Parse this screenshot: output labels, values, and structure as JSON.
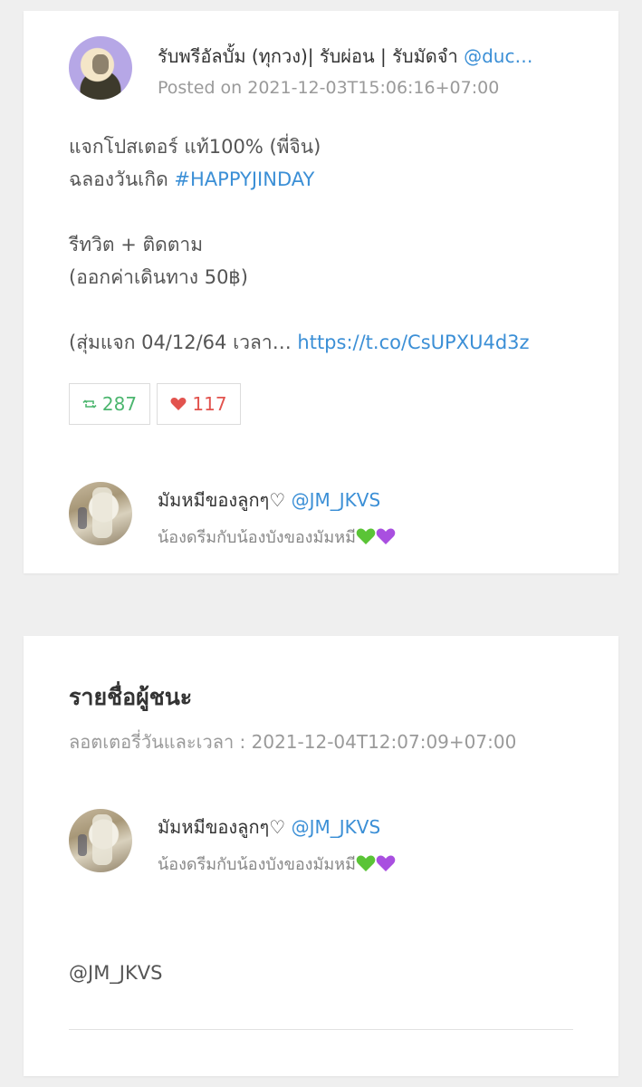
{
  "post": {
    "title_prefix": "รับพรีอัลบั้ม (ทุกวง)| รับผ่อน | รับมัดจำ",
    "title_handle": "@duc…",
    "posted": "Posted on 2021-12-03T15:06:16+07:00",
    "lines": [
      "แจกโปสเตอร์ แท้100% (พี่จิน)",
      "ฉลองวันเกิด"
    ],
    "hashtag": "#HAPPYJINDAY",
    "lines2": [
      "รีทวิต + ติดตาม",
      "(ออกค่าเดินทาง 50฿)"
    ],
    "draw_text": "(สุ่มแจก 04/12/64 เวลา…",
    "link": "https://t.co/CsUPXU4d3z",
    "retweets": "287",
    "likes": "117",
    "icons": {
      "retweet": "retweet-icon",
      "like": "heart-icon"
    },
    "colors": {
      "retweet": "#4cb66f",
      "like": "#e2534e",
      "link": "#3b8fd6"
    }
  },
  "participant": {
    "name": "มัมหมีของลูกๆ♡",
    "handle": "@JM_JKVS",
    "bio": "น้องดรีมกับน้องบังของมัมหมี"
  },
  "winners": {
    "heading": "รายชื่อผู้ชนะ",
    "draw_time": "ลอตเตอรี่วันและเวลา : 2021-12-04T12:07:09+07:00",
    "winner": {
      "name": "มัมหมีของลูกๆ♡",
      "handle": "@JM_JKVS",
      "bio": "น้องดรีมกับน้องบังของมัมหมี"
    },
    "mention": "@JM_JKVS"
  }
}
